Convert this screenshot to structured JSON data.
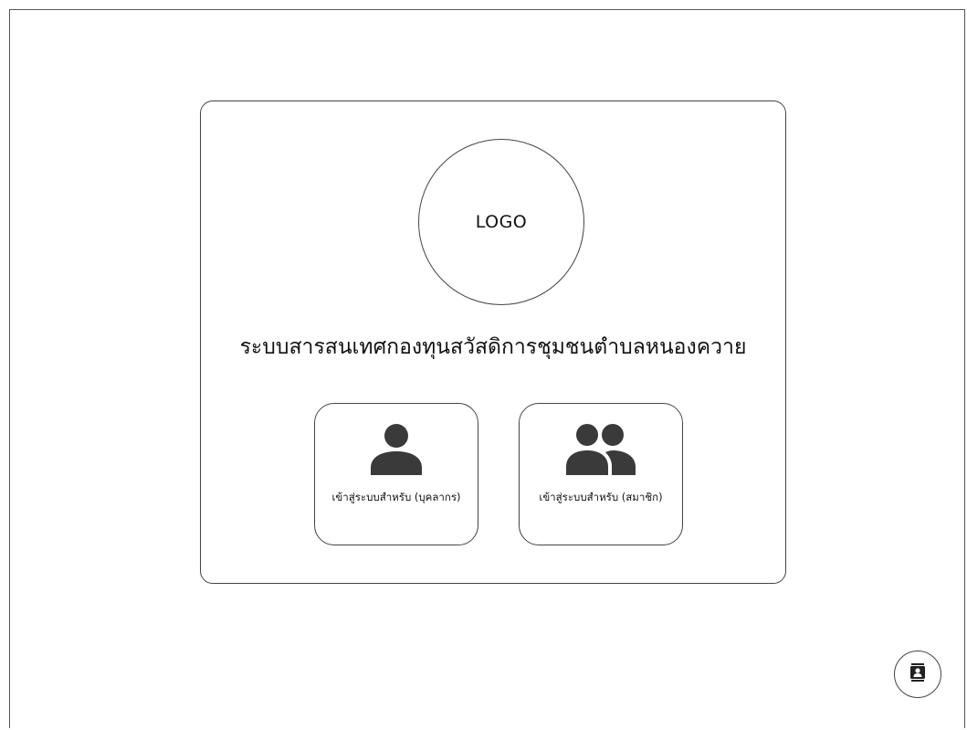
{
  "logo": {
    "text": "LOGO"
  },
  "system_title": "ระบบสารสนเทศกองทุนสวัสดิการชุมชนตำบลหนองควาย",
  "login_options": [
    {
      "label": "เข้าสู่ระบบสำหรับ (บุคลากร)",
      "icon": "person-icon"
    },
    {
      "label": "เข้าสู่ระบบสำหรับ (สมาชิก)",
      "icon": "group-icon"
    }
  ],
  "fab": {
    "icon": "contact-card-icon"
  },
  "colors": {
    "border": "#444444",
    "icon": "#3a3a3a",
    "background": "#ffffff",
    "text": "#111111"
  }
}
